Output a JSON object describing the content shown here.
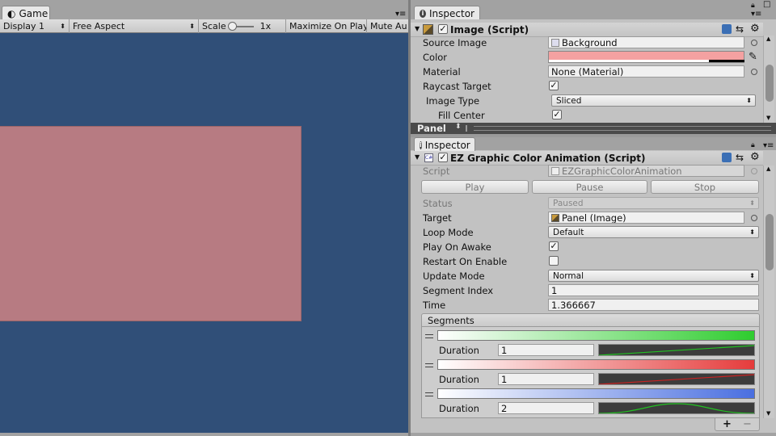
{
  "game_tab": {
    "label": "Game"
  },
  "toolbar": {
    "display": "Display 1",
    "aspect": "Free Aspect",
    "scale_label": "Scale",
    "scale_value": "1x",
    "maximize": "Maximize On Play",
    "mute": "Mute Au"
  },
  "inspector_top": {
    "tab": "Inspector",
    "component": "Image (Script)",
    "fields": [
      {
        "label": "Source Image",
        "value": "Background"
      },
      {
        "label": "Color",
        "value": ""
      },
      {
        "label": "Material",
        "value": "None (Material)"
      },
      {
        "label": "Raycast Target",
        "value": ""
      },
      {
        "label": "Image Type",
        "value": "Sliced"
      },
      {
        "label": "Fill Center",
        "value": ""
      }
    ],
    "color_swatch": "#f4a1a1",
    "bottom_label": "Panel"
  },
  "inspector_bottom": {
    "tab": "Inspector",
    "component": "EZ Graphic Color Animation (Script)",
    "script_label": "Script",
    "script_value": "EZGraphicColorAnimation",
    "buttons": {
      "play": "Play",
      "pause": "Pause",
      "stop": "Stop"
    },
    "fields": {
      "status": {
        "label": "Status",
        "value": "Paused"
      },
      "target": {
        "label": "Target",
        "value": "Panel (Image)"
      },
      "loop_mode": {
        "label": "Loop Mode",
        "value": "Default"
      },
      "play_on_awake": {
        "label": "Play On Awake"
      },
      "restart_on_enable": {
        "label": "Restart On Enable"
      },
      "update_mode": {
        "label": "Update Mode",
        "value": "Normal"
      },
      "segment_index": {
        "label": "Segment Index",
        "value": "1"
      },
      "time": {
        "label": "Time",
        "value": "1.366667"
      }
    },
    "segments_label": "Segments",
    "segments": [
      {
        "duration_label": "Duration",
        "duration": "1",
        "color": "#2ecc2e"
      },
      {
        "duration_label": "Duration",
        "duration": "1",
        "color": "#e53c3c"
      },
      {
        "duration_label": "Duration",
        "duration": "2",
        "color": "#4a6fe0"
      }
    ],
    "add": "+",
    "remove": "−"
  },
  "colors": {
    "game_bg": "#304f78",
    "panel_rect": "#b77b82"
  }
}
